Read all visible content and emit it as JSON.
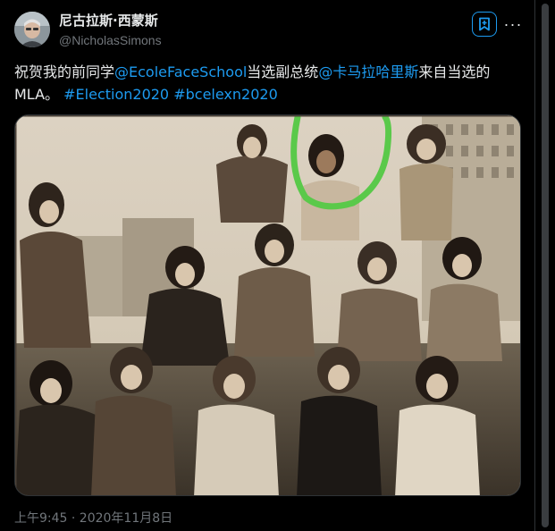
{
  "author": {
    "display_name": "尼古拉斯·西蒙斯",
    "handle": "@NicholasSimons",
    "avatar_icon": "user-avatar"
  },
  "actions": {
    "bookmark_icon": "bookmark-icon",
    "more_icon": "more-horizontal-icon",
    "more_label": "···"
  },
  "tweet": {
    "text_part1": "祝贺我的前同学",
    "mention1": "@EcoleFaceSchool",
    "text_part2": "当选副总统",
    "mention2": "@卡马拉哈里斯",
    "text_part3": "来自当选的MLA。",
    "hashtag1": "#Election2020",
    "hashtag2": "#bcelexn2020"
  },
  "media": {
    "type": "photo",
    "highlight_color": "#5ac94a"
  },
  "timestamp": "上午9:45 · 2020年11月8日",
  "colors": {
    "background": "#000000",
    "link": "#1d9bf0",
    "secondary_text": "#71767b",
    "primary_text": "#e7e9ea"
  }
}
